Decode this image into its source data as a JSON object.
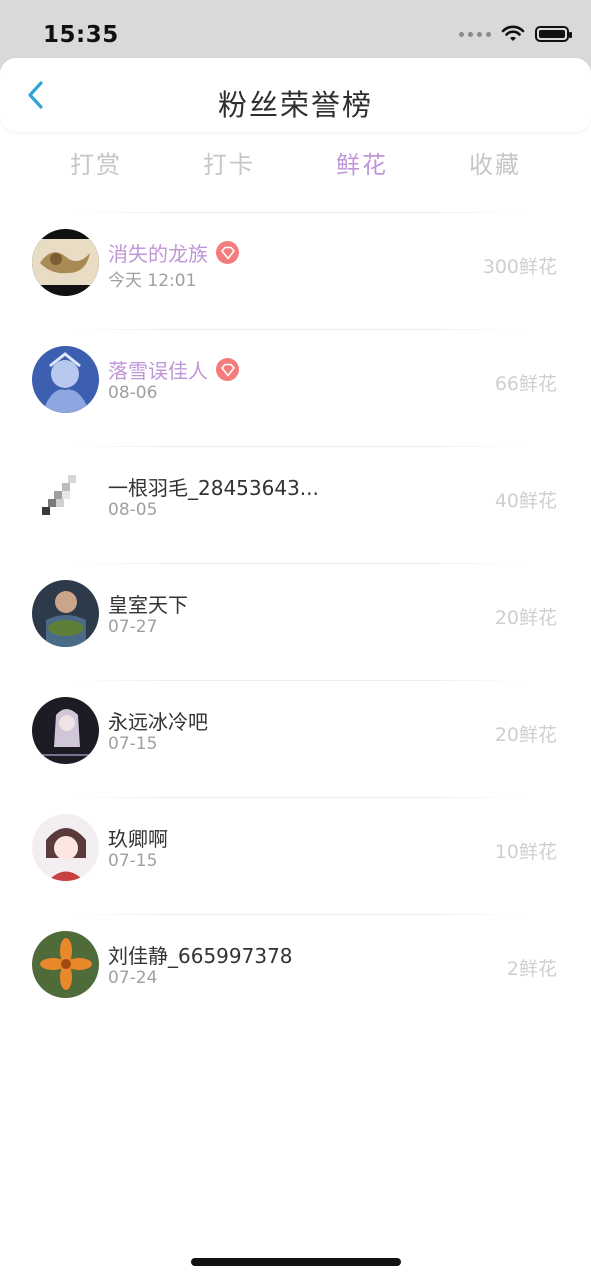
{
  "status": {
    "time": "15:35"
  },
  "header": {
    "title": "粉丝荣誉榜"
  },
  "tabs": [
    {
      "label": "打赏",
      "active": false
    },
    {
      "label": "打卡",
      "active": false
    },
    {
      "label": "鲜花",
      "active": true
    },
    {
      "label": "收藏",
      "active": false
    }
  ],
  "colors": {
    "accent": "#bf97d8",
    "badge": "#f47c7c",
    "back": "#2fa4d9"
  },
  "fans": [
    {
      "name": "消失的龙族",
      "date": "今天 12:01",
      "amount": "300鲜花",
      "vip": true
    },
    {
      "name": "落雪误佳人",
      "date": "08-06",
      "amount": "66鲜花",
      "vip": true
    },
    {
      "name": "一根羽毛_28453643...",
      "date": "08-05",
      "amount": "40鲜花",
      "vip": false
    },
    {
      "name": "皇室天下",
      "date": "07-27",
      "amount": "20鲜花",
      "vip": false
    },
    {
      "name": "永远冰冷吧",
      "date": "07-15",
      "amount": "20鲜花",
      "vip": false
    },
    {
      "name": "玖卿啊",
      "date": "07-15",
      "amount": "10鲜花",
      "vip": false
    },
    {
      "name": "刘佳静_665997378",
      "date": "07-24",
      "amount": "2鲜花",
      "vip": false
    }
  ]
}
